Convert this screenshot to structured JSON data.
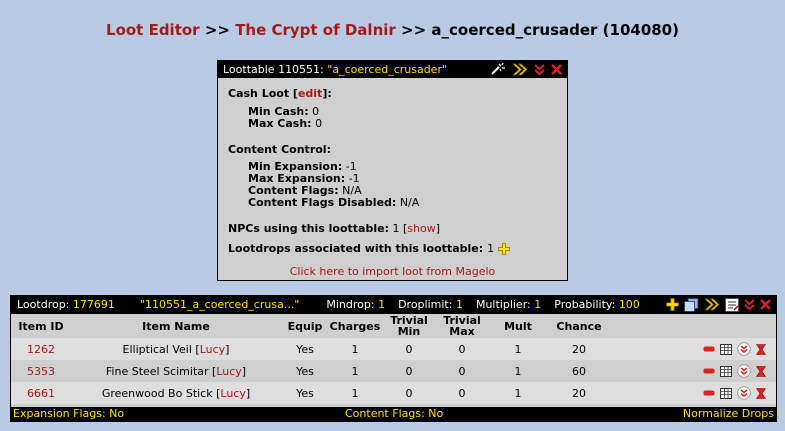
{
  "breadcrumb": {
    "loot_editor": "Loot Editor",
    "sep1": ">>",
    "zone": "The Crypt of Dalnir",
    "sep2": ">>",
    "npc": "a_coerced_crusader (104080)"
  },
  "loottable": {
    "header_label": "Loottable 110551:",
    "header_name": "\"a_coerced_crusader\"",
    "cash_loot_label": "Cash Loot [",
    "cash_edit": "edit",
    "cash_loot_end": "]:",
    "min_cash_label": "Min Cash:",
    "min_cash": "0",
    "max_cash_label": "Max Cash:",
    "max_cash": "0",
    "content_control_label": "Content Control:",
    "min_expansion_label": "Min Expansion:",
    "min_expansion": "-1",
    "max_expansion_label": "Max Expansion:",
    "max_expansion": "-1",
    "content_flags_label": "Content Flags:",
    "content_flags": "N/A",
    "content_flags_disabled_label": "Content Flags Disabled:",
    "content_flags_disabled": "N/A",
    "npcs_label": "NPCs using this loottable:",
    "npcs_count": "1",
    "npcs_show": "show",
    "lootdrops_label": "Lootdrops associated with this loottable:",
    "lootdrops_count": "1",
    "import_link": "Click here to import loot from Magelo"
  },
  "lootdrop": {
    "label": "Lootdrop:",
    "id": "177691",
    "name": "\"110551_a_coerced_crusa...\"",
    "mindrop_label": "Mindrop:",
    "mindrop": "1",
    "droplimit_label": "Droplimit:",
    "droplimit": "1",
    "multiplier_label": "Multiplier:",
    "multiplier": "1",
    "probability_label": "Probability:",
    "probability": "100",
    "columns": {
      "item_id": "Item ID",
      "item_name": "Item Name",
      "equip": "Equip",
      "charges": "Charges",
      "trivial_min_1": "Trivial",
      "trivial_min_2": "Min",
      "trivial_max_1": "Trivial",
      "trivial_max_2": "Max",
      "mult": "Mult",
      "chance": "Chance"
    },
    "rows": [
      {
        "id": "1262",
        "name": "Elliptical Veil",
        "maker": "Lucy",
        "equip": "Yes",
        "charges": "1",
        "tmin": "0",
        "tmax": "0",
        "mult": "1",
        "chance": "20"
      },
      {
        "id": "5353",
        "name": "Fine Steel Scimitar",
        "maker": "Lucy",
        "equip": "Yes",
        "charges": "1",
        "tmin": "0",
        "tmax": "0",
        "mult": "1",
        "chance": "60"
      },
      {
        "id": "6661",
        "name": "Greenwood Bo Stick",
        "maker": "Lucy",
        "equip": "Yes",
        "charges": "1",
        "tmin": "0",
        "tmax": "0",
        "mult": "1",
        "chance": "20"
      }
    ],
    "footer": {
      "expansion_flags": "Expansion Flags: No",
      "content_flags": "Content Flags: No",
      "normalize": "Normalize Drops"
    }
  },
  "colors": {
    "background": "#b9cbe4",
    "link": "#a51919",
    "highlight": "#ffe000",
    "panel": "#cfcfcf"
  },
  "icons": [
    "wand-icon",
    "double-chevron-right-icon",
    "double-chevron-down-icon",
    "delete-x-icon",
    "add-plus-icon",
    "copy-icon",
    "edit-list-icon",
    "minus-icon",
    "table-icon",
    "chevron-circle-down-icon"
  ]
}
